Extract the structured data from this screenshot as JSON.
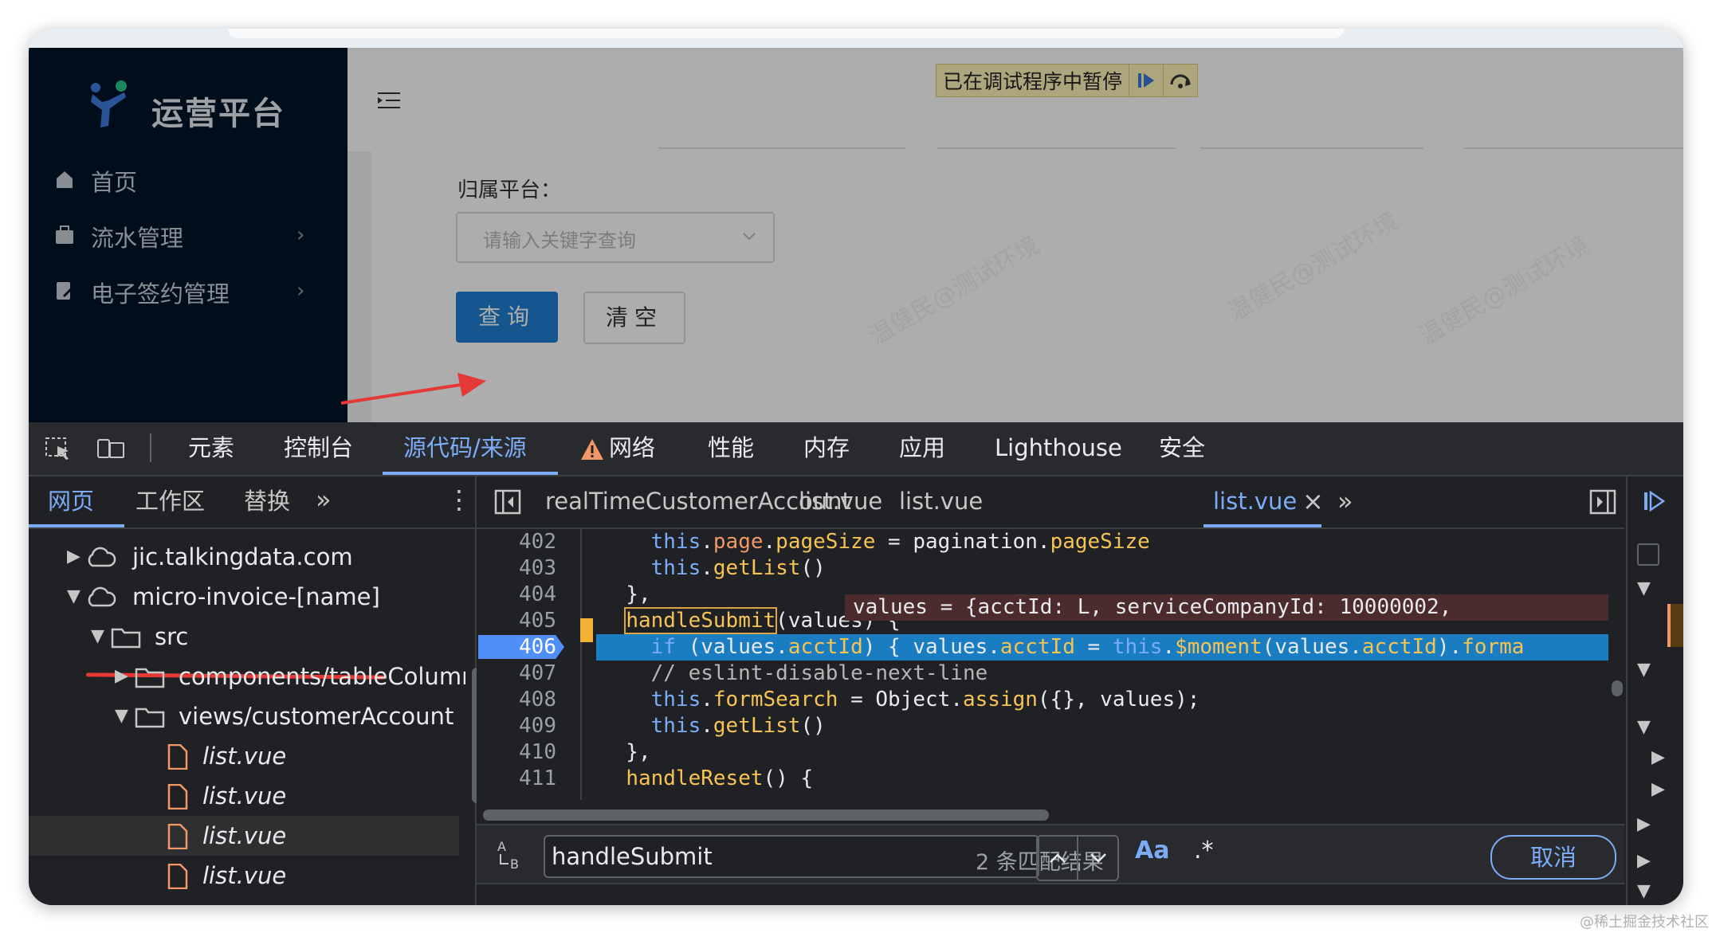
{
  "app": {
    "title": "运营平台",
    "sidebar": {
      "items": [
        {
          "label": "首页",
          "icon": "home-icon",
          "has_arrow": false
        },
        {
          "label": "流水管理",
          "icon": "briefcase-icon",
          "has_arrow": true
        },
        {
          "label": "电子签约管理",
          "icon": "sign-document-icon",
          "has_arrow": true
        }
      ],
      "arrow": "›"
    },
    "debug_banner": {
      "text": "已在调试程序中暂停"
    },
    "form": {
      "platform_label": "归属平台：",
      "platform_placeholder": "请输入关键字查询",
      "query_button": "查询",
      "clear_button": "清空"
    },
    "watermark": "温健民@测试环境"
  },
  "devtools": {
    "tabs": [
      "元素",
      "控制台",
      "源代码/来源",
      "网络",
      "性能",
      "内存",
      "应用",
      "Lighthouse",
      "安全"
    ],
    "active_tab": "源代码/来源",
    "navigator": {
      "tabs": [
        "网页",
        "工作区",
        "替换"
      ],
      "more": "»",
      "kebab": "⋮",
      "tree": [
        {
          "label": "jic.talkingdata.com",
          "type": "domain",
          "depth": 0,
          "expanded": false
        },
        {
          "label": "micro-invoice-[name]",
          "type": "domain",
          "depth": 0,
          "expanded": true
        },
        {
          "label": "src",
          "type": "folder",
          "depth": 1,
          "expanded": true
        },
        {
          "label": "components/tableColumnT",
          "type": "folder",
          "depth": 2,
          "expanded": false
        },
        {
          "label": "views/customerAccount",
          "type": "folder",
          "depth": 2,
          "expanded": true
        },
        {
          "label": "list.vue",
          "type": "file",
          "depth": 3,
          "selected": false
        },
        {
          "label": "list.vue",
          "type": "file",
          "depth": 3,
          "selected": false
        },
        {
          "label": "list.vue",
          "type": "file",
          "depth": 3,
          "selected": true
        },
        {
          "label": "list.vue",
          "type": "file",
          "depth": 3,
          "selected": false
        }
      ]
    },
    "editor": {
      "tabs": [
        "realTimeCustomerAccount",
        "list.vue",
        "list.vue",
        "list.vue"
      ],
      "active_tab_index": 3,
      "close": "×",
      "more": "»",
      "breakpoint_line": 406,
      "lines": [
        {
          "n": 402,
          "text": "    this.page.pageSize = pagination.pageSize"
        },
        {
          "n": 403,
          "text": "    this.getList()"
        },
        {
          "n": 404,
          "text": "  },"
        },
        {
          "n": 405,
          "text": "  handleSubmit(values) {"
        },
        {
          "n": 406,
          "text": "    if (values.acctId) { values.acctId = this.$moment(values.acctId).forma"
        },
        {
          "n": 407,
          "text": "    // eslint-disable-next-line"
        },
        {
          "n": 408,
          "text": "    this.formSearch = Object.assign({}, values);"
        },
        {
          "n": 409,
          "text": "    this.getList()"
        },
        {
          "n": 410,
          "text": "  },"
        },
        {
          "n": 411,
          "text": "  handleReset() {"
        }
      ],
      "inline_value": "values = {acctId: L, serviceCompanyId: 10000002,"
    },
    "search": {
      "query": "handleSubmit",
      "match_count": "2 条匹配结果",
      "case_label": "Aa",
      "regex_label": ".*",
      "cancel": "取消"
    }
  },
  "credit": "@稀土掘金技术社区",
  "colors": {
    "sidebar_bg": "#001529",
    "primary": "#1f7fd1",
    "devtools_bg": "#202124",
    "devtools_accent": "#7cacf8",
    "exec_line": "#1a7cc1",
    "annotation_red": "#e53935"
  }
}
